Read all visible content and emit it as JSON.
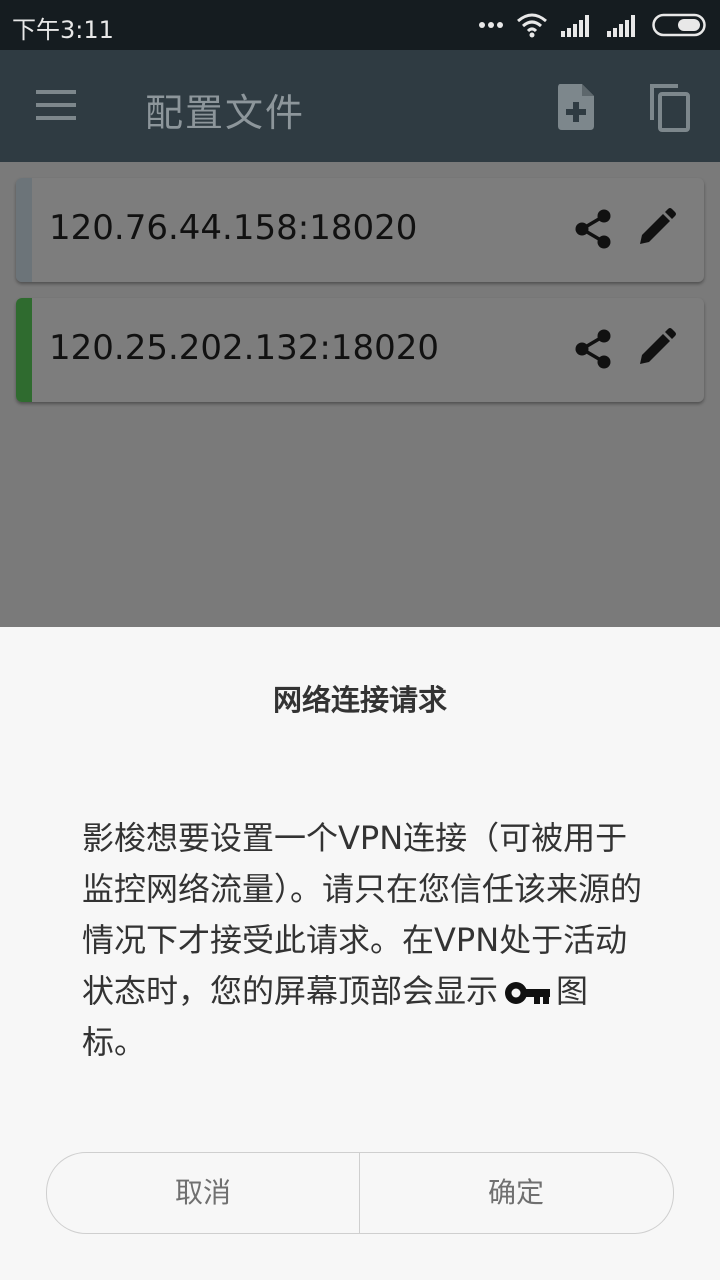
{
  "status_bar": {
    "time": "下午3:11",
    "icons": [
      "more-dots-icon",
      "wifi-icon",
      "signal-icon",
      "signal-icon",
      "battery-icon"
    ]
  },
  "app_bar": {
    "title": "配置文件",
    "icons": [
      "menu-icon",
      "new-file-icon",
      "copy-icon"
    ]
  },
  "profiles": [
    {
      "host": "120.76.44.158:18020",
      "stripe_color": "#6c7479"
    },
    {
      "host": "120.25.202.132:18020",
      "stripe_color": "#2f6b2f"
    }
  ],
  "dialog": {
    "title": "网络连接请求",
    "message_before_icon": "影梭想要设置一个VPN连接（可被用于监控网络流量）。请只在您信任该来源的情况下才接受此请求。在VPN处于活动状态时，您的屏幕顶部会显示",
    "message_after_icon": "图标。",
    "icon": "key-icon",
    "cancel_label": "取消",
    "ok_label": "确定"
  },
  "colors": {
    "app_bar": "#2f3b42",
    "status_bar": "#151c20",
    "dialog_bg": "#f7f7f7"
  }
}
